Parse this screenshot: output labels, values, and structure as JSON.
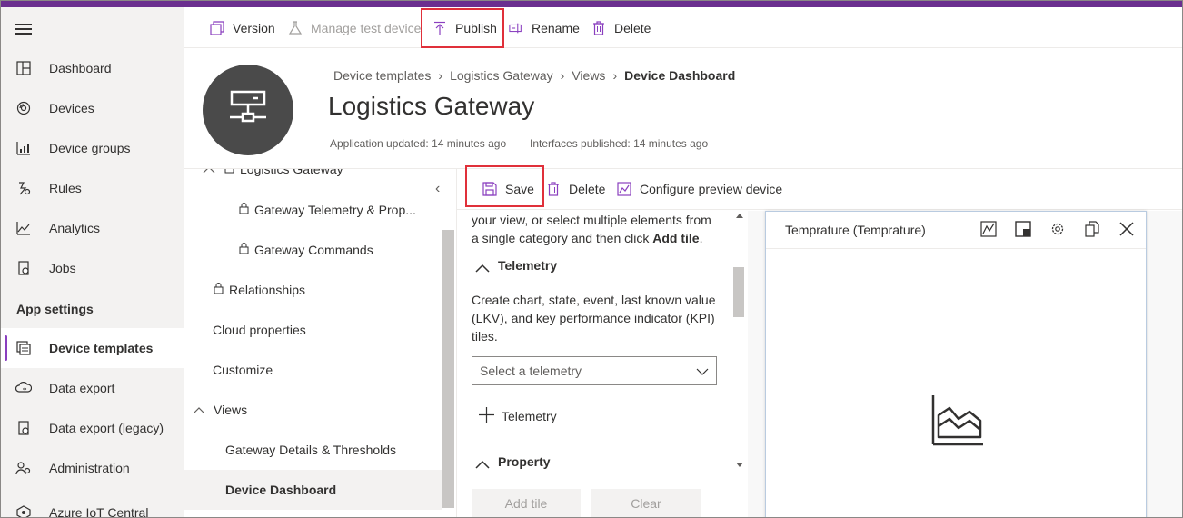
{
  "colors": {
    "accent": "#6b2f8f",
    "active_indicator": "#8a3fbf",
    "highlight_box": "#e0303a"
  },
  "sidebar": {
    "items": [
      {
        "label": "Dashboard",
        "icon": "dashboard-icon"
      },
      {
        "label": "Devices",
        "icon": "devices-icon"
      },
      {
        "label": "Device groups",
        "icon": "device-groups-icon"
      },
      {
        "label": "Rules",
        "icon": "rules-icon"
      },
      {
        "label": "Analytics",
        "icon": "analytics-icon"
      },
      {
        "label": "Jobs",
        "icon": "jobs-icon"
      }
    ],
    "section_title": "App settings",
    "settings_items": [
      {
        "label": "Device templates",
        "icon": "device-templates-icon",
        "active": true
      },
      {
        "label": "Data export",
        "icon": "data-export-icon"
      },
      {
        "label": "Data export (legacy)",
        "icon": "data-export-legacy-icon"
      },
      {
        "label": "Administration",
        "icon": "administration-icon"
      },
      {
        "label": "Azure IoT Central",
        "icon": "azure-iot-central-icon"
      }
    ]
  },
  "toolbar": {
    "version": "Version",
    "manage_test_device": "Manage test device",
    "publish": "Publish",
    "rename": "Rename",
    "delete": "Delete"
  },
  "header": {
    "breadcrumb": [
      "Device templates",
      "Logistics Gateway",
      "Views",
      "Device Dashboard"
    ],
    "title": "Logistics Gateway",
    "app_updated": "Application updated: 14 minutes ago",
    "interfaces_published": "Interfaces published: 14 minutes ago"
  },
  "tree": {
    "root": "Logistics Gateway",
    "items": [
      "Gateway Telemetry & Prop...",
      "Gateway Commands",
      "Relationships",
      "Cloud properties",
      "Customize",
      "Views",
      "Gateway Details & Thresholds",
      "Device Dashboard"
    ]
  },
  "edit_toolbar": {
    "save": "Save",
    "delete": "Delete",
    "configure_preview": "Configure preview device"
  },
  "library": {
    "intro_line1": "your view, or select multiple elements from",
    "intro_line2_prefix": "a single category and then click ",
    "intro_line2_bold": "Add tile",
    "intro_line2_suffix": ".",
    "telemetry_heading": "Telemetry",
    "telemetry_desc_1": "Create chart, state, event, last known value",
    "telemetry_desc_2": "(LKV), and key performance indicator (KPI)",
    "telemetry_desc_3": "tiles.",
    "select_placeholder": "Select a telemetry",
    "add_telemetry": "Telemetry",
    "property_heading": "Property",
    "add_tile": "Add tile",
    "clear": "Clear"
  },
  "tile": {
    "title": "Temprature (Temprature)"
  }
}
